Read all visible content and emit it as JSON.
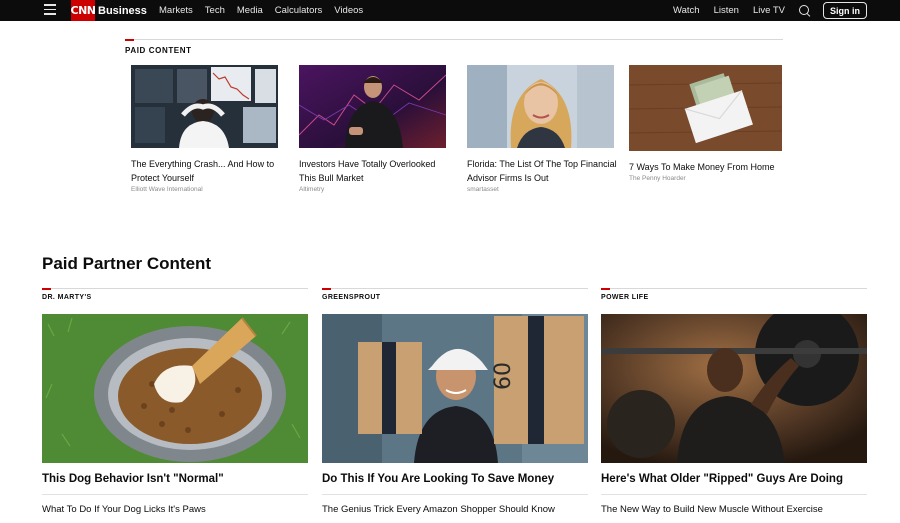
{
  "nav": {
    "logo_mark": "CNN",
    "brand": "Business",
    "links": [
      "Markets",
      "Tech",
      "Media",
      "Calculators",
      "Videos"
    ],
    "right_links": [
      "Watch",
      "Listen",
      "Live TV"
    ],
    "signin_label": "Sign in"
  },
  "paid_content": {
    "label": "PAID CONTENT",
    "items": [
      {
        "title": "The Everything Crash... And How to Protect Yourself",
        "source": "Elliott Wave International"
      },
      {
        "title": "Investors Have Totally Overlooked This Bull Market",
        "source": "Altimetry"
      },
      {
        "title": "Florida: The List Of The Top Financial Advisor Firms Is Out",
        "source": "smartasset"
      },
      {
        "title": "7 Ways To Make Money From Home",
        "source": "The Penny Hoarder"
      }
    ]
  },
  "partner": {
    "heading": "Paid Partner Content",
    "items": [
      {
        "brand": "DR. MARTY'S",
        "title": "This Dog Behavior Isn't \"Normal\"",
        "subtitle": "What To Do If Your Dog Licks It's Paws"
      },
      {
        "brand": "GREENSPROUT",
        "title": "Do This If You Are Looking To Save Money",
        "subtitle": "The Genius Trick Every Amazon Shopper Should Know"
      },
      {
        "brand": "POWER LIFE",
        "title": "Here's What Older \"Ripped\" Guys Are Doing",
        "subtitle": "The New Way to Build New Muscle Without Exercise"
      }
    ]
  },
  "colors": {
    "accent": "#cc0000",
    "nav_bg": "#0c0c0c"
  },
  "icons": [
    "menu-icon",
    "search-icon"
  ]
}
